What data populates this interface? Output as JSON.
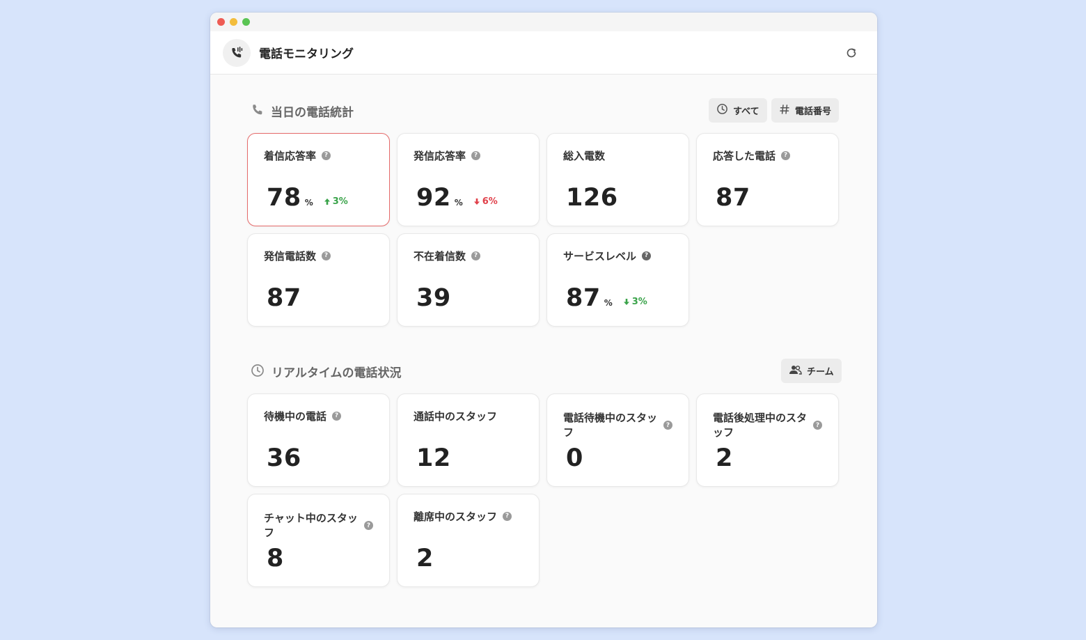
{
  "app": {
    "title": "電話モニタリング"
  },
  "daily_section": {
    "title": "当日の電話統計",
    "filter_all_label": "すべて",
    "filter_number_label": "電話番号",
    "cards": [
      {
        "label": "着信応答率",
        "value": "78",
        "unit": "%",
        "delta": "3%",
        "delta_dir": "up"
      },
      {
        "label": "発信応答率",
        "value": "92",
        "unit": "%",
        "delta": "6%",
        "delta_dir": "down"
      },
      {
        "label": "総入電数",
        "value": "126"
      },
      {
        "label": "応答した電話",
        "value": "87"
      },
      {
        "label": "発信電話数",
        "value": "87"
      },
      {
        "label": "不在着信数",
        "value": "39"
      },
      {
        "label": "サービスレベル",
        "value": "87",
        "unit": "%",
        "delta": "3%",
        "delta_dir": "down-green"
      }
    ]
  },
  "realtime_section": {
    "title": "リアルタイムの電話状況",
    "team_label": "チーム",
    "cards": [
      {
        "label": "待機中の電話",
        "value": "36"
      },
      {
        "label": "通話中のスタッフ",
        "value": "12"
      },
      {
        "label": "電話待機中のスタッフ",
        "value": "0"
      },
      {
        "label": "電話後処理中のスタッフ",
        "value": "2"
      },
      {
        "label": "チャット中のスタッフ",
        "value": "8"
      },
      {
        "label": "離席中のスタッフ",
        "value": "2"
      }
    ]
  },
  "help_glyph": "?",
  "icons": {
    "app": "phone-wave-icon",
    "refresh": "refresh-icon",
    "phone": "phone-icon",
    "clock": "clock-icon",
    "hash": "hash-icon",
    "team": "team-icon",
    "help": "help-icon",
    "arrow_up": "arrow-up-icon",
    "arrow_down": "arrow-down-icon"
  },
  "colors": {
    "background": "#d7e4fb",
    "active_border": "#e56a6a",
    "delta_up": "#3aa34a",
    "delta_down": "#e0404a"
  }
}
